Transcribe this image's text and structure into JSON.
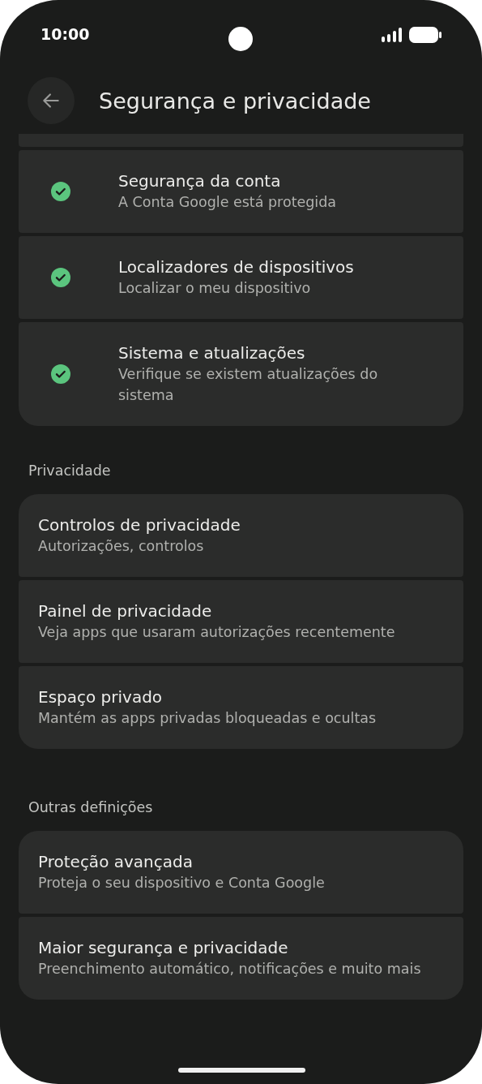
{
  "status_bar": {
    "time": "10:00"
  },
  "header": {
    "title": "Segurança e privacidade"
  },
  "groups": [
    {
      "cut_top": true,
      "items": [
        {
          "title": "Segurança da conta",
          "subtitle": "A Conta Google está protegida",
          "kind": "check"
        },
        {
          "title": "Localizadores de dispositivos",
          "subtitle": "Localizar o meu dispositivo",
          "kind": "check"
        },
        {
          "title": "Sistema e atualizações",
          "subtitle": "Verifique se existem atualizações do sistema",
          "kind": "check"
        }
      ]
    },
    {
      "label": "Privacidade",
      "items": [
        {
          "title": "Controlos de privacidade",
          "subtitle": "Autorizações, controlos"
        },
        {
          "title": "Painel de privacidade",
          "subtitle": "Veja apps que usaram autorizações recentemente"
        },
        {
          "title": "Espaço privado",
          "subtitle": "Mantém as apps privadas bloqueadas e ocultas"
        }
      ]
    },
    {
      "label": "Outras definições",
      "items": [
        {
          "title": "Proteção avançada",
          "subtitle": "Proteja o seu dispositivo e Conta Google"
        },
        {
          "title": "Maior segurança e privacidade",
          "subtitle": "Preenchimento automático, notificações e muito mais"
        }
      ]
    }
  ]
}
